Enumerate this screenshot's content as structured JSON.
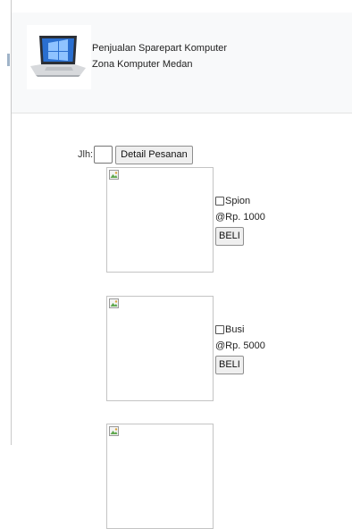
{
  "header": {
    "title_line1": "Penjualan Sparepart Komputer",
    "title_line2": "Zona Komputer Medan"
  },
  "order": {
    "qty_label": "Jlh:",
    "qty_value": "",
    "detail_button": "Detail Pesanan"
  },
  "products": [
    {
      "name": "Spion",
      "price": "@Rp. 1000",
      "buy_label": "BELI"
    },
    {
      "name": "Busi",
      "price": "@Rp. 5000",
      "buy_label": "BELI"
    }
  ]
}
